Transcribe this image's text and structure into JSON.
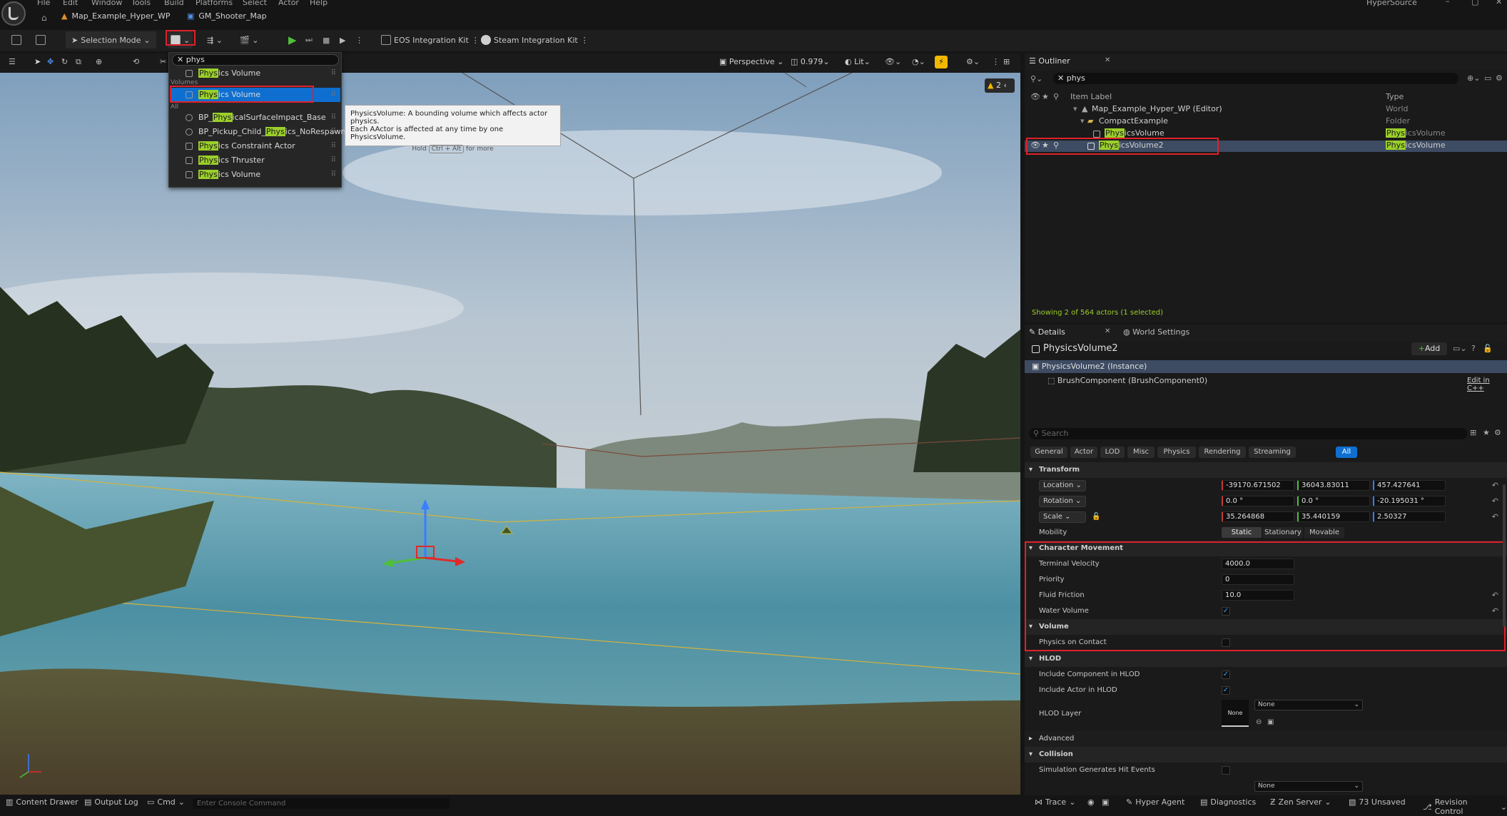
{
  "menu": [
    "File",
    "Edit",
    "Window",
    "Tools",
    "Build",
    "Platforms",
    "Select",
    "Actor",
    "Help"
  ],
  "app_title": "HyperSource",
  "tabs": {
    "map": "Map_Example_Hyper_WP",
    "game": "GM_Shooter_Map"
  },
  "toolbar": {
    "selection_mode": "Selection Mode",
    "eos": "EOS Integration Kit",
    "steam": "Steam Integration Kit"
  },
  "viewport": {
    "perspective": "Perspective",
    "fov": "0.979",
    "lit": "Lit",
    "warning_count": "2"
  },
  "dropdown": {
    "search": "phys",
    "section_volumes": "Volumes",
    "section_all": "All",
    "items": [
      {
        "pre": "",
        "hl": "Phys",
        "post": "ics Volume"
      },
      {
        "pre": "",
        "hl": "Phys",
        "post": "ics Volume"
      },
      {
        "pre": "BP_",
        "hl": "Phys",
        "post": "icalSurfaceImpact_Base"
      },
      {
        "pre": "BP_Pickup_Child_",
        "hl": "Phys",
        "post": "ics_NoRespawn"
      },
      {
        "pre": "",
        "hl": "Phys",
        "post": "ics Constraint Actor"
      },
      {
        "pre": "",
        "hl": "Phys",
        "post": "ics Thruster"
      },
      {
        "pre": "",
        "hl": "Phys",
        "post": "ics Volume"
      }
    ]
  },
  "tooltip": {
    "line1": "PhysicsVolume: A bounding volume which affects actor physics.",
    "line2": "Each AActor is affected at any time by one PhysicsVolume.",
    "hold": "Hold",
    "keys": "Ctrl + Alt",
    "more": "for more"
  },
  "outliner": {
    "title": "Outliner",
    "search": "phys",
    "col_label": "Item Label",
    "col_type": "Type",
    "rows": [
      {
        "label": "Map_Example_Hyper_WP (Editor)",
        "type": "World"
      },
      {
        "label": "CompactExample",
        "type": "Folder"
      },
      {
        "hl": "Phys",
        "post": "icsVolume",
        "type_hl": "Phys",
        "type_post": "icsVolume"
      },
      {
        "hl": "Phys",
        "post": "icsVolume2",
        "type_hl": "Phys",
        "type_post": "icsVolume"
      }
    ],
    "status": "Showing 2 of 564 actors (1 selected)"
  },
  "details": {
    "title": "Details",
    "world_settings": "World Settings",
    "actor_name": "PhysicsVolume2",
    "add": "Add",
    "instance": "PhysicsVolume2 (Instance)",
    "component": "BrushComponent (BrushComponent0)",
    "edit_cpp": "Edit in C++",
    "search_placeholder": "Search",
    "filter_tabs": [
      "General",
      "Actor",
      "LOD",
      "Misc",
      "Physics",
      "Rendering",
      "Streaming",
      "All"
    ],
    "transform": {
      "header": "Transform",
      "location": "Location",
      "loc": [
        "-39170.671502",
        "36043.83011",
        "457.427641"
      ],
      "rotation": "Rotation",
      "rot": [
        "0.0 °",
        "0.0 °",
        "-20.195031 °"
      ],
      "scale": "Scale",
      "scl": [
        "35.264868",
        "35.440159",
        "2.50327"
      ],
      "mobility": "Mobility",
      "mob": [
        "Static",
        "Stationary",
        "Movable"
      ]
    },
    "char_move": {
      "header": "Character Movement",
      "tv": "Terminal Velocity",
      "tv_val": "4000.0",
      "prio": "Priority",
      "prio_val": "0",
      "ff": "Fluid Friction",
      "ff_val": "10.0",
      "wv": "Water Volume"
    },
    "volume": {
      "header": "Volume",
      "poc": "Physics on Contact"
    },
    "hlod": {
      "header": "HLOD",
      "icih": "Include Component in HLOD",
      "iaih": "Include Actor in HLOD",
      "layer": "HLOD Layer",
      "none_thumb": "None",
      "none_dd": "None"
    },
    "advanced": "Advanced",
    "collision": {
      "header": "Collision",
      "sghe": "Simulation Generates Hit Events",
      "none": "None"
    }
  },
  "statusbar": {
    "content": "Content Drawer",
    "output": "Output Log",
    "cmd": "Cmd",
    "console_ph": "Enter Console Command",
    "trace": "Trace",
    "hyper": "Hyper Agent",
    "diag": "Diagnostics",
    "zen": "Zen Server",
    "unsaved": "73 Unsaved",
    "rev": "Revision Control"
  }
}
